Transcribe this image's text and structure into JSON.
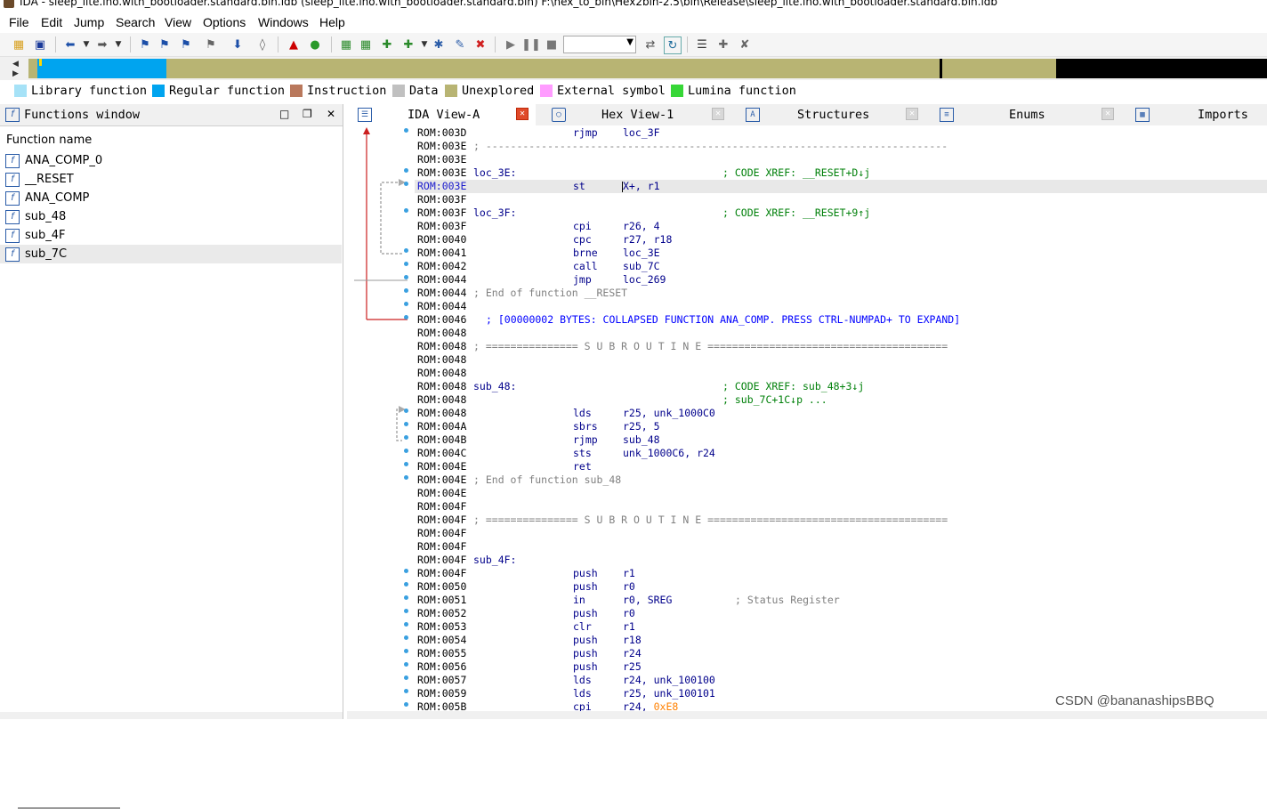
{
  "window": {
    "title": "IDA - sleep_lite.ino.with_bootloader.standard.bin.idb (sleep_lite.ino.with_bootloader.standard.bin) F:\\hex_to_bin\\Hex2bin-2.5\\bin\\Release\\sleep_lite.ino.with_bootloader.standard.bin.idb"
  },
  "menu": [
    "File",
    "Edit",
    "Jump",
    "Search",
    "View",
    "Options",
    "Windows",
    "Help"
  ],
  "legend": [
    {
      "label": "Library function",
      "color": "#a6e2f7"
    },
    {
      "label": "Regular function",
      "color": "#00a4ef"
    },
    {
      "label": "Instruction",
      "color": "#b9785c"
    },
    {
      "label": "Data",
      "color": "#c0c0c0"
    },
    {
      "label": "Unexplored",
      "color": "#b8b473"
    },
    {
      "label": "External symbol",
      "color": "#ff9cff"
    },
    {
      "label": "Lumina function",
      "color": "#37d737"
    }
  ],
  "functions_window": {
    "title": "Functions window",
    "column": "Function name",
    "items": [
      "ANA_COMP_0",
      "__RESET",
      "ANA_COMP",
      "sub_48",
      "sub_4F",
      "sub_7C"
    ],
    "selected": "sub_7C"
  },
  "tabs": [
    {
      "label": "IDA View-A",
      "active": true
    },
    {
      "label": "Hex View-1",
      "active": false
    },
    {
      "label": "Structures",
      "active": false
    },
    {
      "label": "Enums",
      "active": false
    },
    {
      "label": "Imports",
      "active": false
    }
  ],
  "listing": [
    {
      "addr": "ROM:003D",
      "mn": "rjmp",
      "op": "loc_3F"
    },
    {
      "addr": "ROM:003E",
      "comment": "; ---------------------------------------------------------------------------"
    },
    {
      "addr": "ROM:003E"
    },
    {
      "addr": "ROM:003E",
      "label": "loc_3E:",
      "xref": "; CODE XREF: __RESET+D↓j"
    },
    {
      "addr": "ROM:003E",
      "mn": "st",
      "op": "X+, r1",
      "highlight": true
    },
    {
      "addr": "ROM:003F"
    },
    {
      "addr": "ROM:003F",
      "label": "loc_3F:",
      "xref": "; CODE XREF: __RESET+9↑j"
    },
    {
      "addr": "ROM:003F",
      "mn": "cpi",
      "op": "r26, 4"
    },
    {
      "addr": "ROM:0040",
      "mn": "cpc",
      "op": "r27, r18"
    },
    {
      "addr": "ROM:0041",
      "mn": "brne",
      "op": "loc_3E"
    },
    {
      "addr": "ROM:0042",
      "mn": "call",
      "op": "sub_7C"
    },
    {
      "addr": "ROM:0044",
      "mn": "jmp",
      "op": "loc_269"
    },
    {
      "addr": "ROM:0044",
      "comment": "; End of function __RESET"
    },
    {
      "addr": "ROM:0044"
    },
    {
      "addr": "ROM:0046",
      "collapsed": "; [00000002 BYTES: COLLAPSED FUNCTION ANA_COMP. PRESS CTRL-NUMPAD+ TO EXPAND]"
    },
    {
      "addr": "ROM:0048"
    },
    {
      "addr": "ROM:0048",
      "comment": "; =============== S U B R O U T I N E ======================================="
    },
    {
      "addr": "ROM:0048"
    },
    {
      "addr": "ROM:0048"
    },
    {
      "addr": "ROM:0048",
      "label": "sub_48:",
      "xref": "; CODE XREF: sub_48+3↓j"
    },
    {
      "addr": "ROM:0048",
      "xref": "; sub_7C+1C↓p ..."
    },
    {
      "addr": "ROM:0048",
      "mn": "lds",
      "op": "r25, unk_1000C0"
    },
    {
      "addr": "ROM:004A",
      "mn": "sbrs",
      "op": "r25, 5"
    },
    {
      "addr": "ROM:004B",
      "mn": "rjmp",
      "op": "sub_48"
    },
    {
      "addr": "ROM:004C",
      "mn": "sts",
      "op": "unk_1000C6, r24"
    },
    {
      "addr": "ROM:004E",
      "mn": "ret"
    },
    {
      "addr": "ROM:004E",
      "comment": "; End of function sub_48"
    },
    {
      "addr": "ROM:004E"
    },
    {
      "addr": "ROM:004F"
    },
    {
      "addr": "ROM:004F",
      "comment": "; =============== S U B R O U T I N E ======================================="
    },
    {
      "addr": "ROM:004F"
    },
    {
      "addr": "ROM:004F"
    },
    {
      "addr": "ROM:004F",
      "label": "sub_4F:"
    },
    {
      "addr": "ROM:004F",
      "mn": "push",
      "op": "r1"
    },
    {
      "addr": "ROM:0050",
      "mn": "push",
      "op": "r0"
    },
    {
      "addr": "ROM:0051",
      "mn": "in",
      "op": "r0, SREG",
      "tailcomment": "; Status Register"
    },
    {
      "addr": "ROM:0052",
      "mn": "push",
      "op": "r0"
    },
    {
      "addr": "ROM:0053",
      "mn": "clr",
      "op": "r1"
    },
    {
      "addr": "ROM:0054",
      "mn": "push",
      "op": "r18"
    },
    {
      "addr": "ROM:0055",
      "mn": "push",
      "op": "r24"
    },
    {
      "addr": "ROM:0056",
      "mn": "push",
      "op": "r25"
    },
    {
      "addr": "ROM:0057",
      "mn": "lds",
      "op": "r24, unk_100100"
    },
    {
      "addr": "ROM:0059",
      "mn": "lds",
      "op": "r25, unk_100101"
    },
    {
      "addr": "ROM:005B",
      "mn": "cpi",
      "op": "r24, ",
      "ophex": "0xE8"
    }
  ],
  "watermark": "CSDN @bananashipsBBQ"
}
